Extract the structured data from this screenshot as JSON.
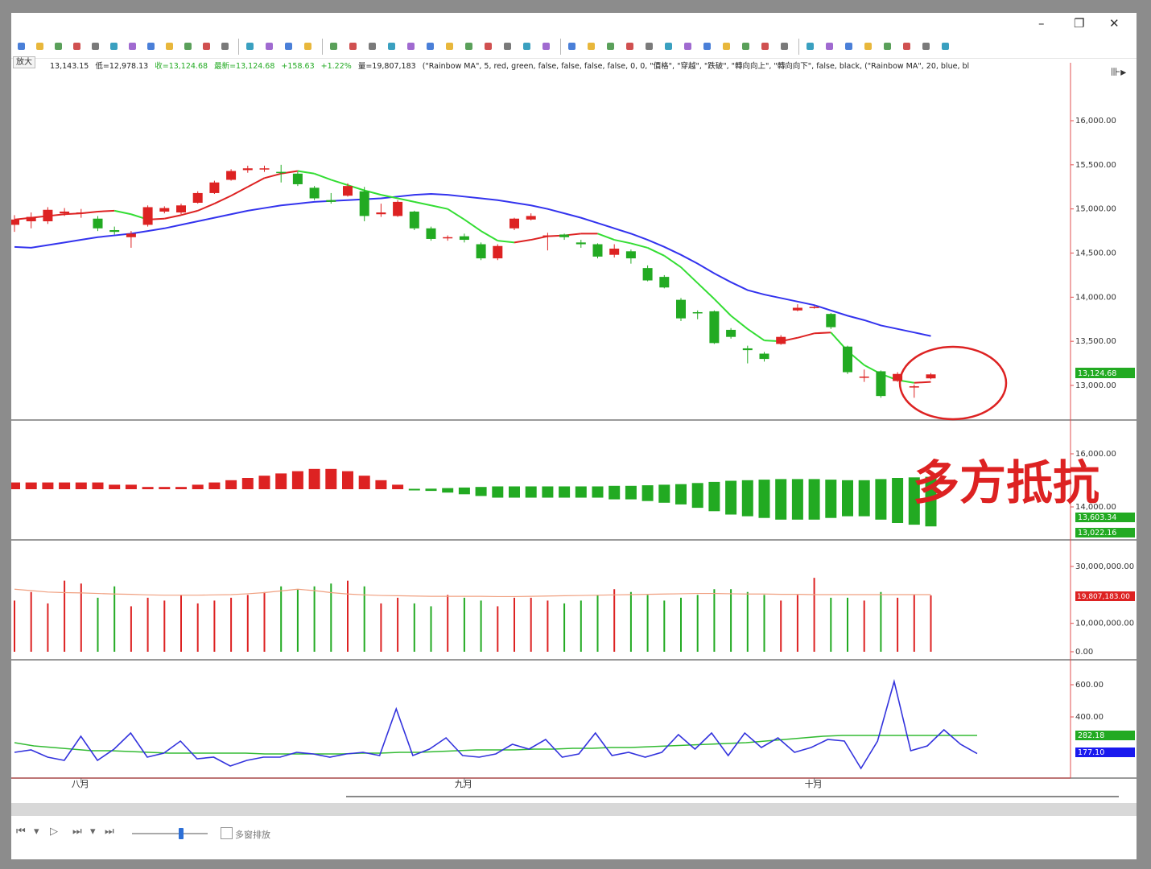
{
  "window": {
    "controls": {
      "minimize": "–",
      "restore": "❐",
      "close": "✕"
    }
  },
  "toolbar": {
    "tooltip": "放大",
    "icons": [
      "zoom-out-icon",
      "zoom-in-icon",
      "arrows-icon",
      "pin-icon",
      "pin-red-icon",
      "move-left-icon",
      "move-right-icon",
      "fit-icon",
      "magnify-plus-icon",
      "magnify-minus-icon",
      "cursor-icon",
      "hand-icon",
      "chat-icon",
      "folder-icon",
      "save-icon",
      "export-icon",
      "window1-icon",
      "window2-icon",
      "window3-icon",
      "window4-icon",
      "window5-icon",
      "window6-icon",
      "window7-icon",
      "indicator1-icon",
      "indicator2-icon",
      "indicator3-icon",
      "indicator4-icon",
      "indicator5-icon",
      "grid-icon",
      "bar-icon",
      "candle-icon",
      "line-icon",
      "check-icon",
      "draw1-icon",
      "draw2-icon",
      "draw3-icon",
      "draw4-icon",
      "draw5-icon",
      "draw6-icon",
      "draw7-icon",
      "pointer-icon",
      "crosshair-icon",
      "layout1-icon",
      "layout2-icon",
      "layout3-icon",
      "layout4-icon",
      "layout5-icon",
      "layout6-icon"
    ]
  },
  "infobar": {
    "open_partial": "13,143.15",
    "low": "低=12,978.13",
    "close": "收=13,124.68",
    "last": "最新=13,124.68",
    "change": "+158.63",
    "pct": "+1.22%",
    "volume": "量=19,807,183",
    "params": "(\"Rainbow MA\", 5, red, green, false, false, false, false, 0, 0, \"價格\", \"穿越\", \"跌破\", \"轉向向上\", \"轉向向下\", false, black, (\"Rainbow MA\", 20, blue, bl"
  },
  "annotation": {
    "text": "多方抵抗"
  },
  "bottom": {
    "multi_label": "多窗排放"
  },
  "colors": {
    "up": "#dd2222",
    "down": "#22aa22",
    "ma5": "#dd2222",
    "ma5_alt": "#33dd33",
    "ma20": "#3333ee",
    "vol_ma": "#f0a080",
    "osc": "#3333dd",
    "osc_ma": "#33bb33",
    "axis_red": "#e05050",
    "circle": "#dd2222"
  },
  "chart_data": {
    "type": "candlestick",
    "x_labels": [
      {
        "index": 4,
        "text": "八月"
      },
      {
        "index": 27,
        "text": "九月"
      },
      {
        "index": 48,
        "text": "十月"
      }
    ],
    "price_panel": {
      "yticks": [
        {
          "v": 16000,
          "t": "16,000.00"
        },
        {
          "v": 15500,
          "t": "15,500.00"
        },
        {
          "v": 15000,
          "t": "15,000.00"
        },
        {
          "v": 14500,
          "t": "14,500.00"
        },
        {
          "v": 14000,
          "t": "14,000.00"
        },
        {
          "v": 13500,
          "t": "13,500.00"
        },
        {
          "v": 13000,
          "t": "13,000.00"
        }
      ],
      "last_value": "13,124.68",
      "ohlc": [
        [
          14820,
          14930,
          14740,
          14880
        ],
        [
          14860,
          14960,
          14780,
          14910
        ],
        [
          14860,
          15020,
          14830,
          14990
        ],
        [
          14950,
          15010,
          14920,
          14970
        ],
        [
          14950,
          15000,
          14900,
          14960
        ],
        [
          14890,
          14920,
          14750,
          14780
        ],
        [
          14760,
          14800,
          14710,
          14740
        ],
        [
          14680,
          14750,
          14560,
          14720
        ],
        [
          14820,
          15040,
          14800,
          15020
        ],
        [
          14970,
          15030,
          14950,
          15010
        ],
        [
          14960,
          15060,
          14940,
          15040
        ],
        [
          15070,
          15200,
          15060,
          15180
        ],
        [
          15180,
          15320,
          15170,
          15300
        ],
        [
          15330,
          15450,
          15320,
          15430
        ],
        [
          15440,
          15490,
          15410,
          15460
        ],
        [
          15450,
          15490,
          15420,
          15460
        ],
        [
          15420,
          15500,
          15300,
          15410
        ],
        [
          15400,
          15420,
          15260,
          15280
        ],
        [
          15240,
          15260,
          15100,
          15120
        ],
        [
          15100,
          15180,
          15060,
          15080
        ],
        [
          15150,
          15290,
          15140,
          15260
        ],
        [
          15200,
          15250,
          14860,
          14920
        ],
        [
          14940,
          15060,
          14910,
          14960
        ],
        [
          14920,
          15100,
          14910,
          15080
        ],
        [
          14970,
          14980,
          14760,
          14780
        ],
        [
          14780,
          14800,
          14640,
          14660
        ],
        [
          14670,
          14700,
          14640,
          14680
        ],
        [
          14690,
          14720,
          14620,
          14650
        ],
        [
          14600,
          14620,
          14420,
          14440
        ],
        [
          14440,
          14600,
          14420,
          14580
        ],
        [
          14780,
          14900,
          14760,
          14890
        ],
        [
          14880,
          14950,
          14870,
          14920
        ],
        [
          14690,
          14730,
          14530,
          14700
        ],
        [
          14710,
          14720,
          14650,
          14680
        ],
        [
          14620,
          14650,
          14560,
          14600
        ],
        [
          14600,
          14610,
          14440,
          14460
        ],
        [
          14480,
          14600,
          14450,
          14550
        ],
        [
          14520,
          14540,
          14380,
          14440
        ],
        [
          14330,
          14360,
          14180,
          14190
        ],
        [
          14230,
          14250,
          14100,
          14110
        ],
        [
          13970,
          13990,
          13730,
          13760
        ],
        [
          13830,
          13850,
          13750,
          13820
        ],
        [
          13840,
          13850,
          13470,
          13480
        ],
        [
          13630,
          13650,
          13530,
          13550
        ],
        [
          13420,
          13450,
          13250,
          13400
        ],
        [
          13360,
          13380,
          13270,
          13300
        ],
        [
          13470,
          13570,
          13460,
          13550
        ],
        [
          13850,
          13920,
          13840,
          13880
        ],
        [
          13880,
          13900,
          13870,
          13890
        ],
        [
          13810,
          13820,
          13640,
          13660
        ],
        [
          13440,
          13450,
          13130,
          13150
        ],
        [
          13100,
          13180,
          13040,
          13100
        ],
        [
          13160,
          13170,
          12860,
          12880
        ],
        [
          13050,
          13150,
          13040,
          13130
        ],
        [
          12980,
          13010,
          12860,
          12990
        ],
        [
          13080,
          13140,
          13070,
          13125
        ]
      ],
      "ma5": [
        14880,
        14900,
        14920,
        14940,
        14950,
        14970,
        14980,
        14940,
        14880,
        14890,
        14930,
        14980,
        15060,
        15150,
        15250,
        15350,
        15400,
        15430,
        15400,
        15330,
        15270,
        15210,
        15160,
        15120,
        15080,
        15040,
        15000,
        14880,
        14750,
        14640,
        14620,
        14650,
        14690,
        14700,
        14720,
        14720,
        14650,
        14610,
        14560,
        14470,
        14340,
        14160,
        13980,
        13790,
        13640,
        13510,
        13500,
        13540,
        13590,
        13600,
        13390,
        13230,
        13130,
        13060,
        13030,
        13040
      ],
      "ma20": [
        14570,
        14560,
        14590,
        14620,
        14650,
        14680,
        14700,
        14720,
        14750,
        14780,
        14820,
        14860,
        14900,
        14940,
        14980,
        15010,
        15040,
        15060,
        15080,
        15090,
        15100,
        15110,
        15120,
        15140,
        15160,
        15170,
        15160,
        15140,
        15120,
        15100,
        15070,
        15040,
        15000,
        14950,
        14900,
        14840,
        14780,
        14720,
        14650,
        14570,
        14480,
        14380,
        14270,
        14170,
        14080,
        14030,
        13990,
        13950,
        13910,
        13850,
        13790,
        13740,
        13680,
        13640,
        13600,
        13560
      ]
    },
    "trend_panel": {
      "yticks": [
        {
          "v": 16000,
          "t": "16,000.00"
        },
        {
          "v": 14000,
          "t": "14,000.00"
        }
      ],
      "values_labels": [
        "13,603.34",
        "13,022.16"
      ],
      "bars": [
        0.3,
        0.3,
        0.3,
        0.3,
        0.3,
        0.3,
        0.2,
        0.2,
        0.1,
        0.1,
        0.1,
        0.2,
        0.3,
        0.4,
        0.5,
        0.6,
        0.7,
        0.8,
        0.9,
        0.9,
        0.8,
        0.6,
        0.4,
        0.2,
        -0.05,
        -0.1,
        -0.2,
        -0.3,
        -0.4,
        -0.5,
        -0.5,
        -0.5,
        -0.5,
        -0.5,
        -0.5,
        -0.5,
        -0.6,
        -0.6,
        -0.7,
        -0.8,
        -0.9,
        -1.1,
        -1.3,
        -1.5,
        -1.6,
        -1.7,
        -1.8,
        -1.8,
        -1.8,
        -1.7,
        -1.6,
        -1.6,
        -1.8,
        -2.0,
        -2.1,
        -2.2
      ]
    },
    "volume_panel": {
      "yticks": [
        {
          "v": 30000000,
          "t": "30,000,000.00"
        },
        {
          "v": 10000000,
          "t": "10,000,000.00"
        },
        {
          "v": 0,
          "t": "0.00"
        }
      ],
      "last_value": "19,807,183.00",
      "volume": [
        18000000,
        21000000,
        17000000,
        25000000,
        24000000,
        19000000,
        23000000,
        16000000,
        19000000,
        18000000,
        20000000,
        17000000,
        18000000,
        19000000,
        20000000,
        21000000,
        23000000,
        22000000,
        23000000,
        24000000,
        25000000,
        23000000,
        17000000,
        19000000,
        17000000,
        16000000,
        20000000,
        19000000,
        18000000,
        16000000,
        19000000,
        19000000,
        18000000,
        17000000,
        18000000,
        20000000,
        22000000,
        21000000,
        20000000,
        18000000,
        19000000,
        20000000,
        22000000,
        22000000,
        21000000,
        20000000,
        18000000,
        20000000,
        26000000,
        19000000,
        19000000,
        18000000,
        21000000,
        19000000,
        20000000,
        19807183
      ],
      "vol_ma": [
        22000000,
        21500000,
        21000000,
        20800000,
        20700000,
        20500000,
        20300000,
        20200000,
        20000000,
        19900000,
        19900000,
        19900000,
        20000000,
        20100000,
        20400000,
        20800000,
        21400000,
        22000000,
        21500000,
        20800000,
        20300000,
        20000000,
        19800000,
        19700000,
        19600000,
        19500000,
        19500000,
        19500000,
        19500000,
        19400000,
        19400000,
        19500000,
        19600000,
        19700000,
        19800000,
        19900000,
        20000000,
        20100000,
        20200000,
        20300000,
        20400000,
        20500000,
        20500000,
        20400000,
        20300000,
        20300000,
        20200000,
        20200000,
        20100000,
        20100000,
        20100000,
        20100000,
        20100000,
        20100000,
        20100000,
        20100000
      ]
    },
    "osc_panel": {
      "yticks": [
        {
          "v": 600,
          "t": "600.00"
        },
        {
          "v": 400,
          "t": "400.00"
        }
      ],
      "labels": [
        "282.18",
        "177.10"
      ],
      "series_a": [
        180,
        195,
        150,
        130,
        280,
        130,
        200,
        300,
        150,
        175,
        250,
        140,
        150,
        95,
        130,
        150,
        150,
        180,
        170,
        150,
        170,
        180,
        160,
        450,
        160,
        200,
        270,
        160,
        150,
        170,
        230,
        200,
        260,
        150,
        170,
        300,
        160,
        180,
        150,
        180,
        290,
        200,
        300,
        160,
        300,
        210,
        270,
        180,
        210,
        260,
        250,
        80,
        250,
        620,
        190,
        220,
        320,
        230,
        172
      ],
      "series_b": [
        240,
        220,
        210,
        200,
        190,
        190,
        185,
        180,
        175,
        175,
        175,
        175,
        175,
        170,
        170,
        170,
        170,
        170,
        175,
        175,
        180,
        180,
        185,
        190,
        195,
        195,
        195,
        200,
        200,
        205,
        205,
        210,
        210,
        215,
        220,
        225,
        230,
        235,
        240,
        250,
        260,
        270,
        280,
        285,
        285,
        285,
        285,
        285,
        285,
        285,
        285
      ]
    }
  }
}
